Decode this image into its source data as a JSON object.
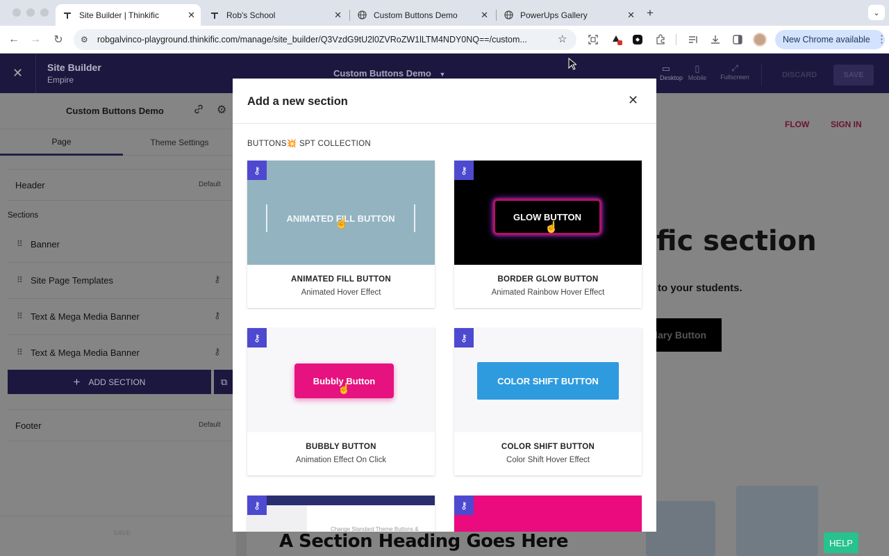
{
  "browser": {
    "tabs": [
      {
        "title": "Site Builder | Thinkific",
        "active": true,
        "icon": "thinkific-icon"
      },
      {
        "title": "Rob's School",
        "active": false,
        "icon": "thinkific-icon"
      },
      {
        "title": "Custom Buttons Demo",
        "active": false,
        "icon": "globe-icon"
      },
      {
        "title": "PowerUps Gallery",
        "active": false,
        "icon": "globe-icon"
      }
    ],
    "url": "robgalvinco-playground.thinkific.com/manage/site_builder/Q3VzdG9tU2l0ZVRoZW1lLTM4NDY0NQ==/custom...",
    "new_chrome_label": "New Chrome available"
  },
  "builder": {
    "title": "Site Builder",
    "theme": "Empire",
    "page_selector": "Custom Buttons Demo",
    "view_modes": [
      "Desktop",
      "Mobile",
      "Fullscreen"
    ],
    "discard_label": "DISCARD",
    "save_label": "SAVE"
  },
  "sidebar": {
    "site_name": "Custom Buttons Demo",
    "tabs": [
      "Page",
      "Theme Settings"
    ],
    "header_label": "Header",
    "header_badge": "Default",
    "sections_label": "Sections",
    "sections": [
      {
        "label": "Banner"
      },
      {
        "label": "Site Page Templates"
      },
      {
        "label": "Text & Mega Media Banner"
      },
      {
        "label": "Text & Mega Media Banner"
      }
    ],
    "add_section_label": "ADD SECTION",
    "footer_label": "Footer",
    "footer_badge": "Default",
    "save_label": "SAVE"
  },
  "preview": {
    "nav_links": [
      "FLOW",
      "SIGN IN"
    ],
    "heading_fragment": "fic section",
    "subtext_fragment": "to your students.",
    "button_fragment": "dary Button",
    "bottom_heading": "A Section Heading Goes Here"
  },
  "modal": {
    "title": "Add a new section",
    "collection_label": "BUTTONS💥 SPT COLLECTION",
    "cards": [
      {
        "title": "ANIMATED FILL BUTTON",
        "subtitle": "Animated Hover Effect",
        "preview_text": "ANIMATED FILL BUTTON",
        "bg": "#93b3c0"
      },
      {
        "title": "BORDER GLOW BUTTON",
        "subtitle": "Animated Rainbow Hover Effect",
        "preview_text": "GLOW BUTTON",
        "bg": "#000000"
      },
      {
        "title": "BUBBLY BUTTON",
        "subtitle": "Animation Effect On Click",
        "preview_text": "Bubbly Button",
        "bg": "#f7f7f9"
      },
      {
        "title": "COLOR SHIFT BUTTON",
        "subtitle": "Color Shift Hover Effect",
        "preview_text": "COLOR SHIFT BUTTON",
        "bg": "#f7f7f9"
      }
    ],
    "partial_cards": [
      {
        "preview_text": "Change Standard Theme Buttons &",
        "bg": "#ffffff"
      },
      {
        "preview_text": "",
        "bg": "#ec0a7f"
      }
    ]
  },
  "help_label": "HELP",
  "colors": {
    "builder_bar": "#1b173f",
    "accent_purple": "#4d4ad0",
    "accent_pink": "#e6127f",
    "accent_blue": "#2e9bdf",
    "help_green": "#27c28e",
    "preview_link": "#c2185b"
  }
}
